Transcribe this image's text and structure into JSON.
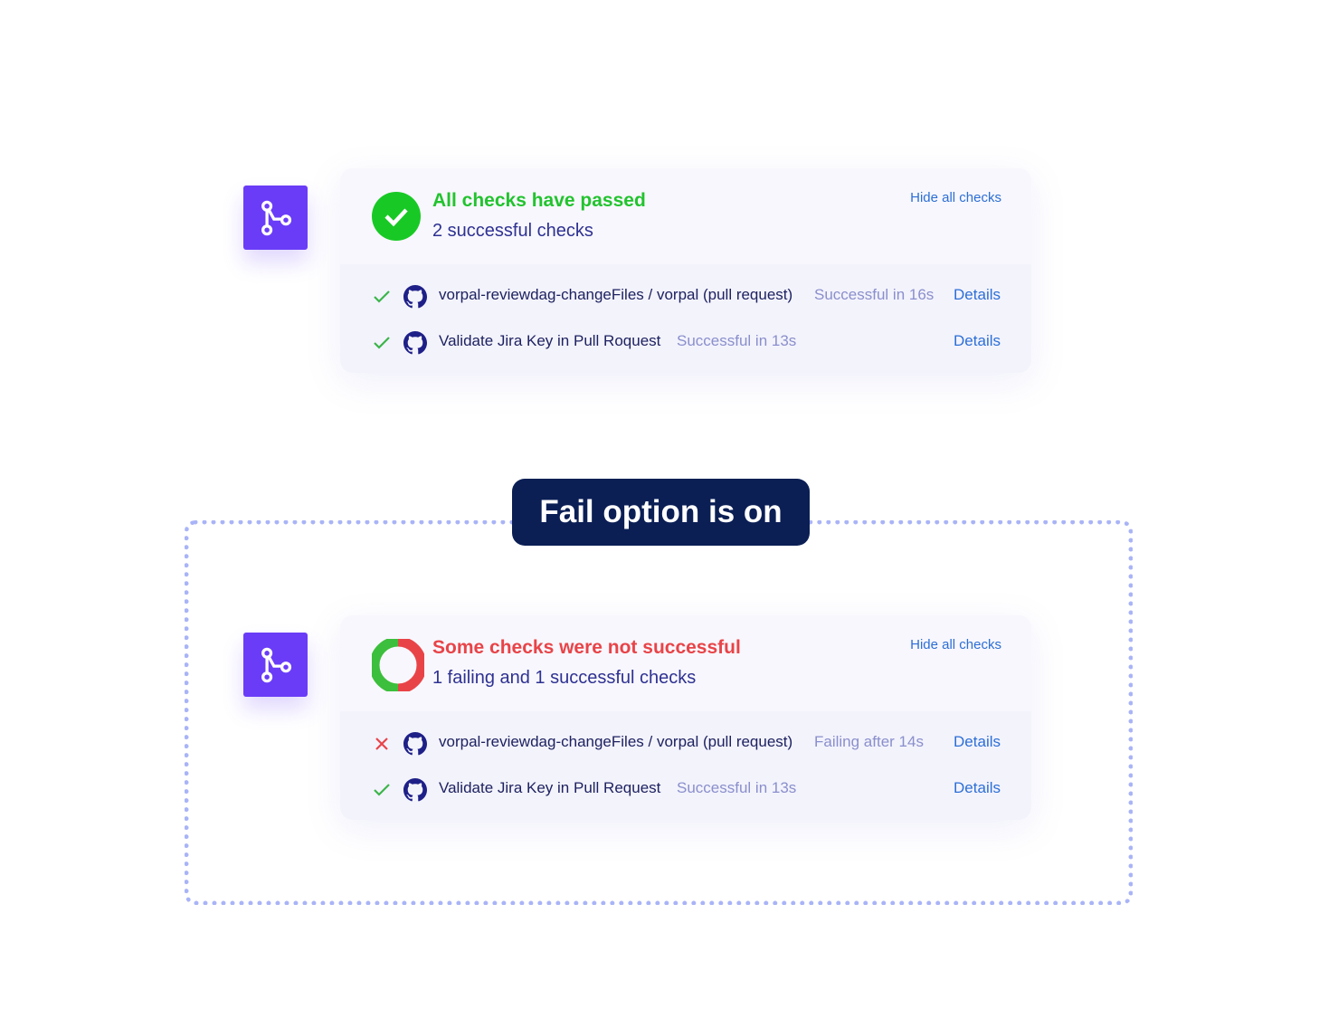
{
  "colors": {
    "success": "#22c32e",
    "failure": "#e84448",
    "accent": "#6a3cf7",
    "link": "#2c6fd6",
    "badge": "#0b1f55"
  },
  "panels": [
    {
      "title": "All checks have passed",
      "subtitle": "2 successful checks",
      "hide_label": "Hide all checks",
      "status": "success",
      "checks": [
        {
          "status": "success",
          "icon": "github-icon",
          "name": "vorpal-reviewdag-changeFiles / vorpal (pull request)",
          "time": "Successful in 16s",
          "details": "Details"
        },
        {
          "status": "success",
          "icon": "github-icon",
          "name": "Validate Jira Key in Pull Roquest",
          "time": "Successful in 13s",
          "details": "Details"
        }
      ]
    },
    {
      "title": "Some checks were not successful",
      "subtitle": "1 failing and 1 successful checks",
      "hide_label": "Hide all checks",
      "status": "mixed",
      "checks": [
        {
          "status": "failure",
          "icon": "github-icon",
          "name": "vorpal-reviewdag-changeFiles / vorpal (pull request)",
          "time": "Failing after 14s",
          "details": "Details"
        },
        {
          "status": "success",
          "icon": "github-icon",
          "name": "Validate Jira Key in Pull Request",
          "time": "Successful in 13s",
          "details": "Details"
        }
      ]
    }
  ],
  "badge": {
    "label": "Fail option is on"
  }
}
